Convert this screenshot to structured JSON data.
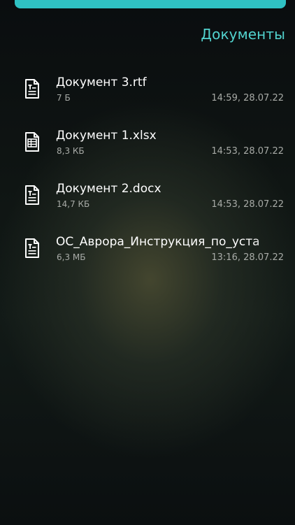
{
  "header": {
    "title": "Документы"
  },
  "files": [
    {
      "name": "Документ 3.rtf",
      "size": "7 Б",
      "date": "14:59, 28.07.22",
      "icon": "text-document-icon"
    },
    {
      "name": "Документ 1.xlsx",
      "size": "8,3 КБ",
      "date": "14:53, 28.07.22",
      "icon": "spreadsheet-icon"
    },
    {
      "name": "Документ 2.docx",
      "size": "14,7 КБ",
      "date": "14:53, 28.07.22",
      "icon": "text-document-icon"
    },
    {
      "name": "ОС_Аврора_Инструкция_по_уста",
      "size": "6,3 МБ",
      "date": "13:16, 28.07.22",
      "icon": "text-document-icon"
    }
  ],
  "colors": {
    "accent": "#52d3cf",
    "top_bar": "#2fc1c3",
    "secondary_text": "#a8aba7"
  }
}
